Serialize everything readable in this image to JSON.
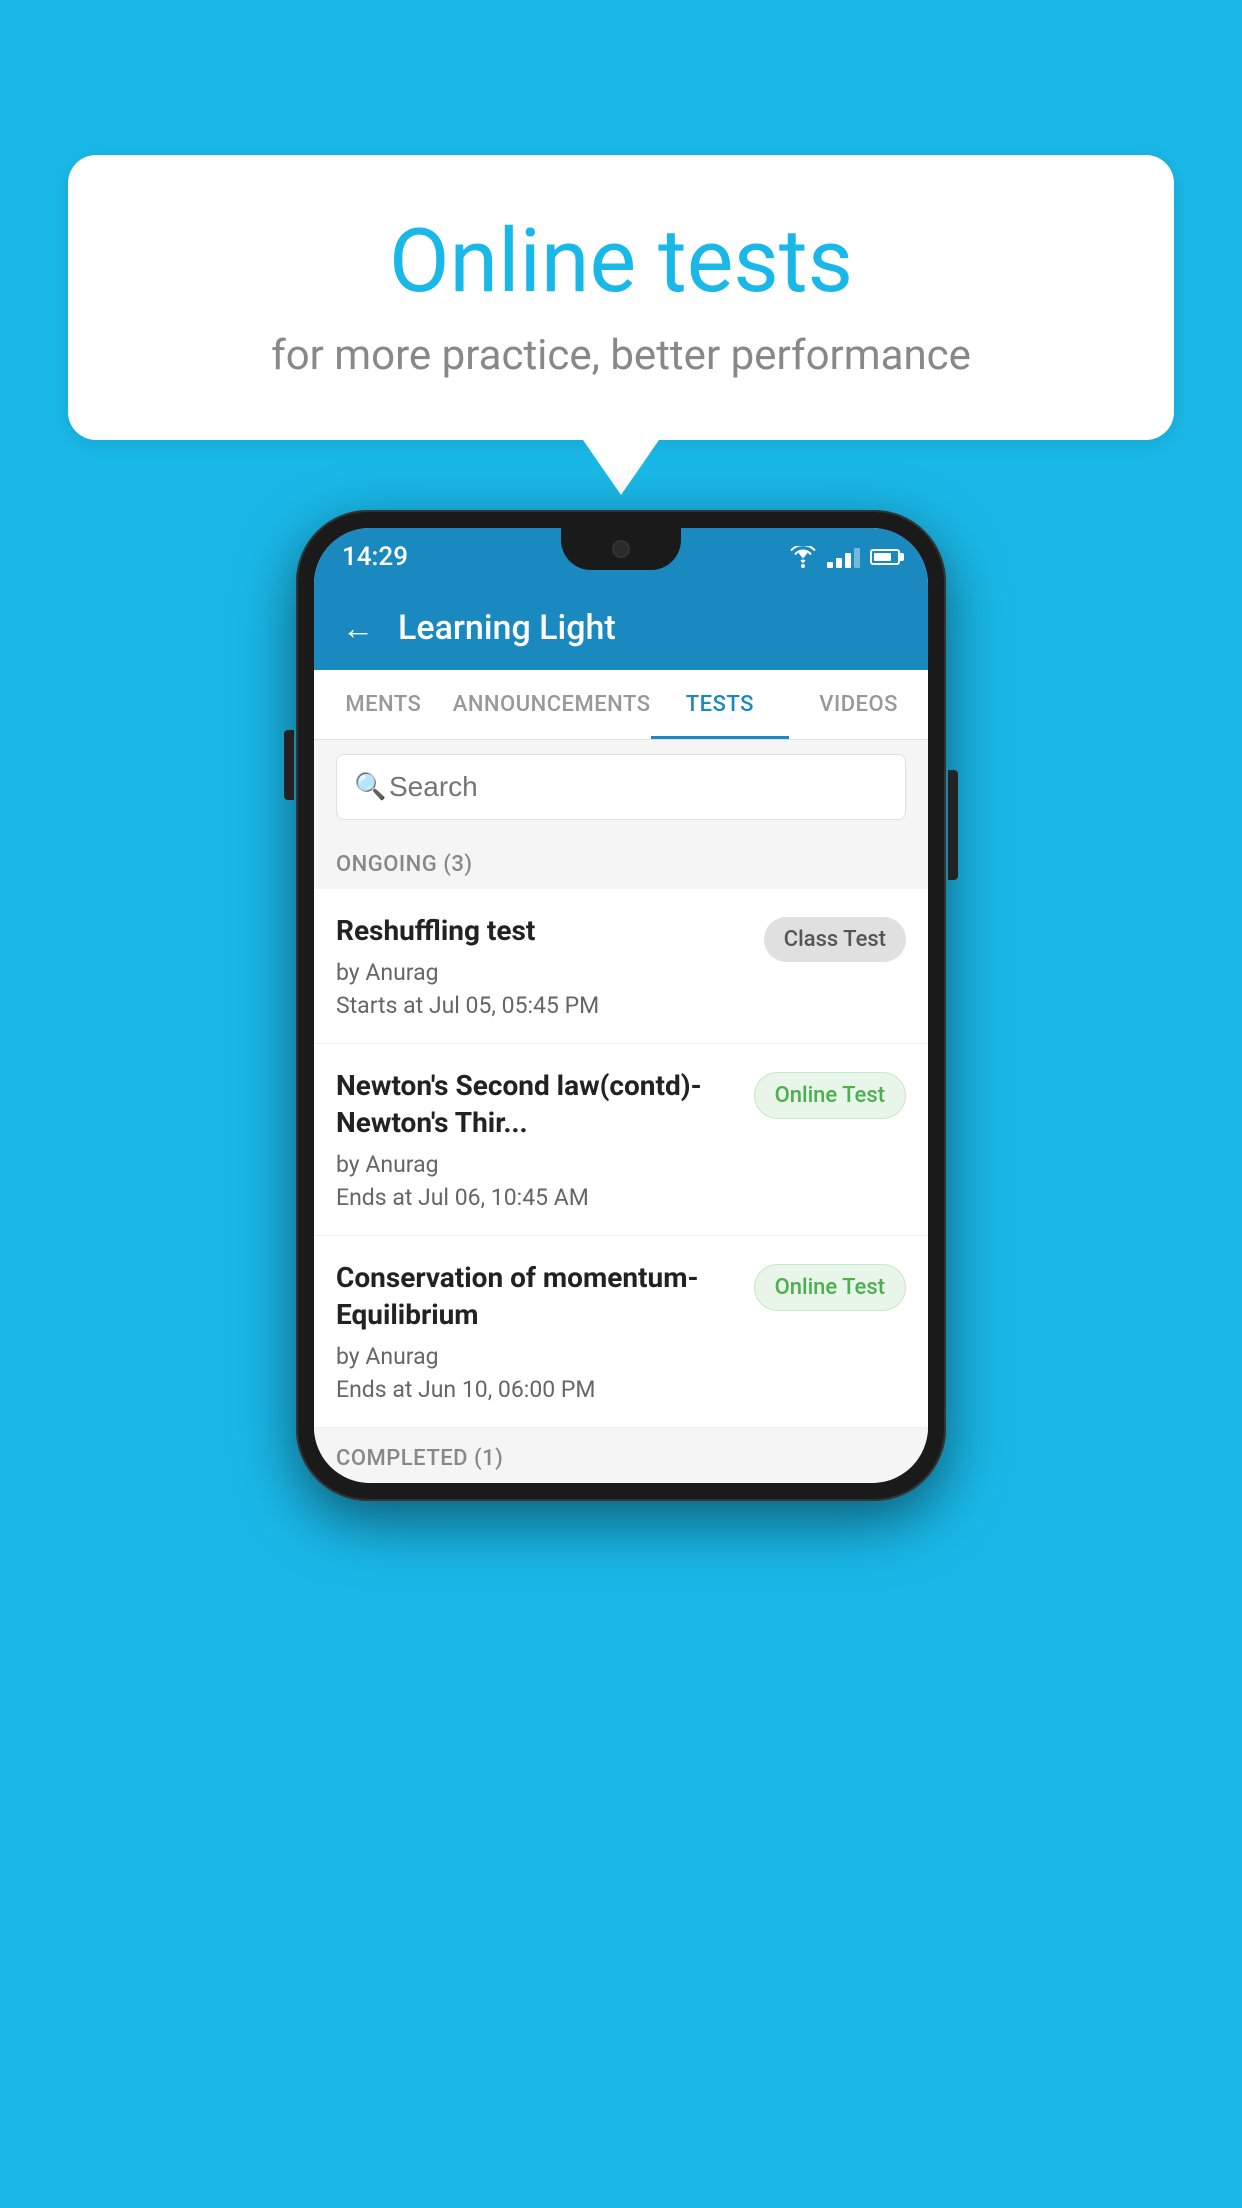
{
  "background": {
    "color": "#1ab8e8"
  },
  "hero": {
    "title": "Online tests",
    "subtitle": "for more practice, better performance"
  },
  "phone": {
    "status_bar": {
      "time": "14:29"
    },
    "header": {
      "back_label": "←",
      "title": "Learning Light"
    },
    "tabs": [
      {
        "label": "MENTS",
        "active": false
      },
      {
        "label": "ANNOUNCEMENTS",
        "active": false
      },
      {
        "label": "TESTS",
        "active": true
      },
      {
        "label": "VIDEOS",
        "active": false
      }
    ],
    "search": {
      "placeholder": "Search"
    },
    "ongoing_section": {
      "label": "ONGOING (3)"
    },
    "tests": [
      {
        "name": "Reshuffling test",
        "author": "by Anurag",
        "date": "Starts at  Jul 05, 05:45 PM",
        "badge": "Class Test",
        "badge_type": "class"
      },
      {
        "name": "Newton's Second law(contd)-Newton's Thir...",
        "author": "by Anurag",
        "date": "Ends at  Jul 06, 10:45 AM",
        "badge": "Online Test",
        "badge_type": "online"
      },
      {
        "name": "Conservation of momentum-Equilibrium",
        "author": "by Anurag",
        "date": "Ends at  Jun 10, 06:00 PM",
        "badge": "Online Test",
        "badge_type": "online"
      }
    ],
    "completed_section": {
      "label": "COMPLETED (1)"
    }
  }
}
